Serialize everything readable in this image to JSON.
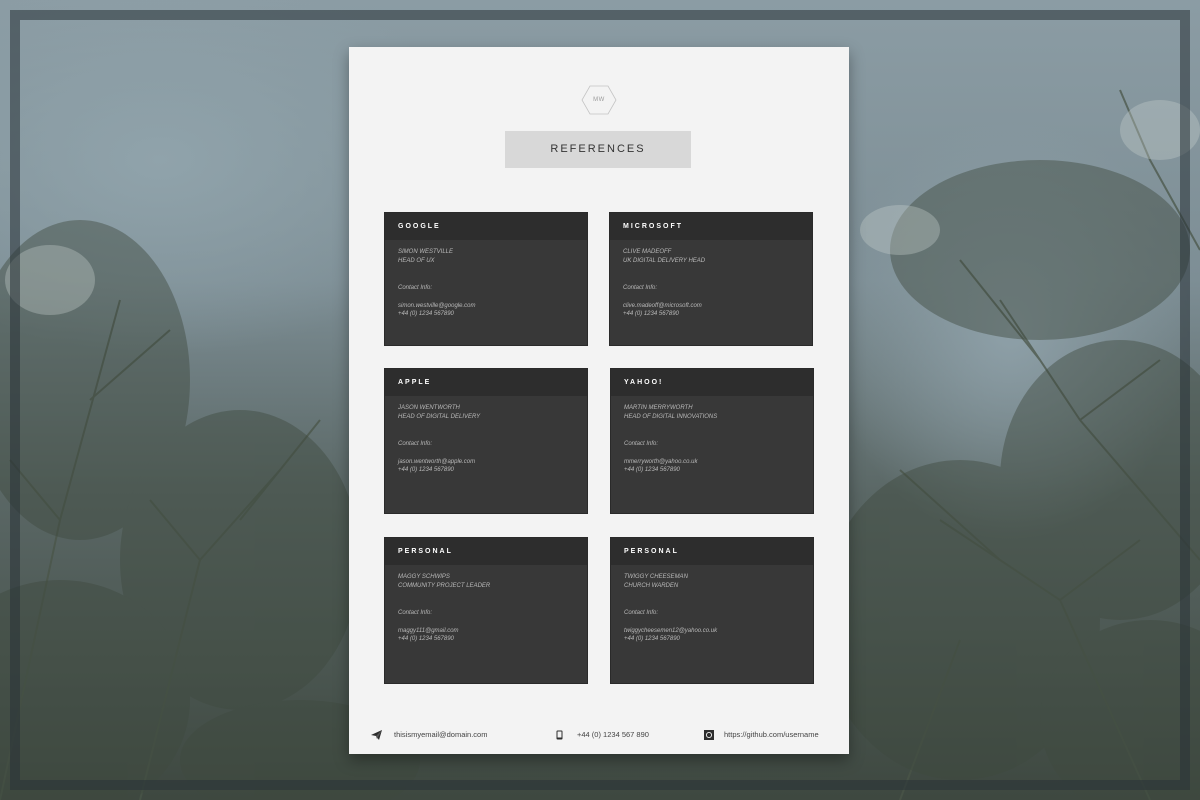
{
  "logo": {
    "initials": "MW"
  },
  "page_title": "REFERENCES",
  "references": [
    {
      "company": "GOOGLE",
      "name": "SIMON WESTVILLE",
      "role": "HEAD OF UX",
      "contact_label": "Contact Info:",
      "email": "simon.westville@google.com",
      "phone": "+44 (0) 1234 567890"
    },
    {
      "company": "MICROSOFT",
      "name": "CLIVE MADEOFF",
      "role": "UK DIGITAL DELIVERY HEAD",
      "contact_label": "Contact Info:",
      "email": "clive.madeoff@microsoft.com",
      "phone": "+44 (0) 1234 567890"
    },
    {
      "company": "APPLE",
      "name": "JASON WENTWORTH",
      "role": "HEAD OF DIGITAL DELIVERY",
      "contact_label": "Contact Info:",
      "email": "jason.wentworth@apple.com",
      "phone": "+44 (0) 1234 567890"
    },
    {
      "company": "YAHOO!",
      "name": "MARTIN MERRYWORTH",
      "role": "HEAD OF DIGITAL INNOVATIONS",
      "contact_label": "Contact Info:",
      "email": "mmerryworth@yahoo.co.uk",
      "phone": "+44 (0) 1234 567890"
    },
    {
      "company": "PERSONAL",
      "name": "MAGGY SCHWIPS",
      "role": "COMMUNITY PROJECT LEADER",
      "contact_label": "Contact Info:",
      "email": "maggy111@gmail.com",
      "phone": "+44 (0) 1234 567890"
    },
    {
      "company": "PERSONAL",
      "name": "TWIGGY CHEESEMAN",
      "role": "CHURCH WARDEN",
      "contact_label": "Contact Info:",
      "email": "twiggycheesemen12@yahoo.co.uk",
      "phone": "+44 (0) 1234 567890"
    }
  ],
  "footer": {
    "email": "thisismyemail@domain.com",
    "phone": "+44 (0) 1234 567 890",
    "github": "https://github.com/username",
    "icons": [
      "paper-plane-icon",
      "mobile-phone-icon",
      "github-icon"
    ]
  },
  "colors": {
    "sheet": "#f3f3f3",
    "card": "#383838",
    "card_header": "#2d2d2d",
    "title_box": "#d8d8d8"
  }
}
